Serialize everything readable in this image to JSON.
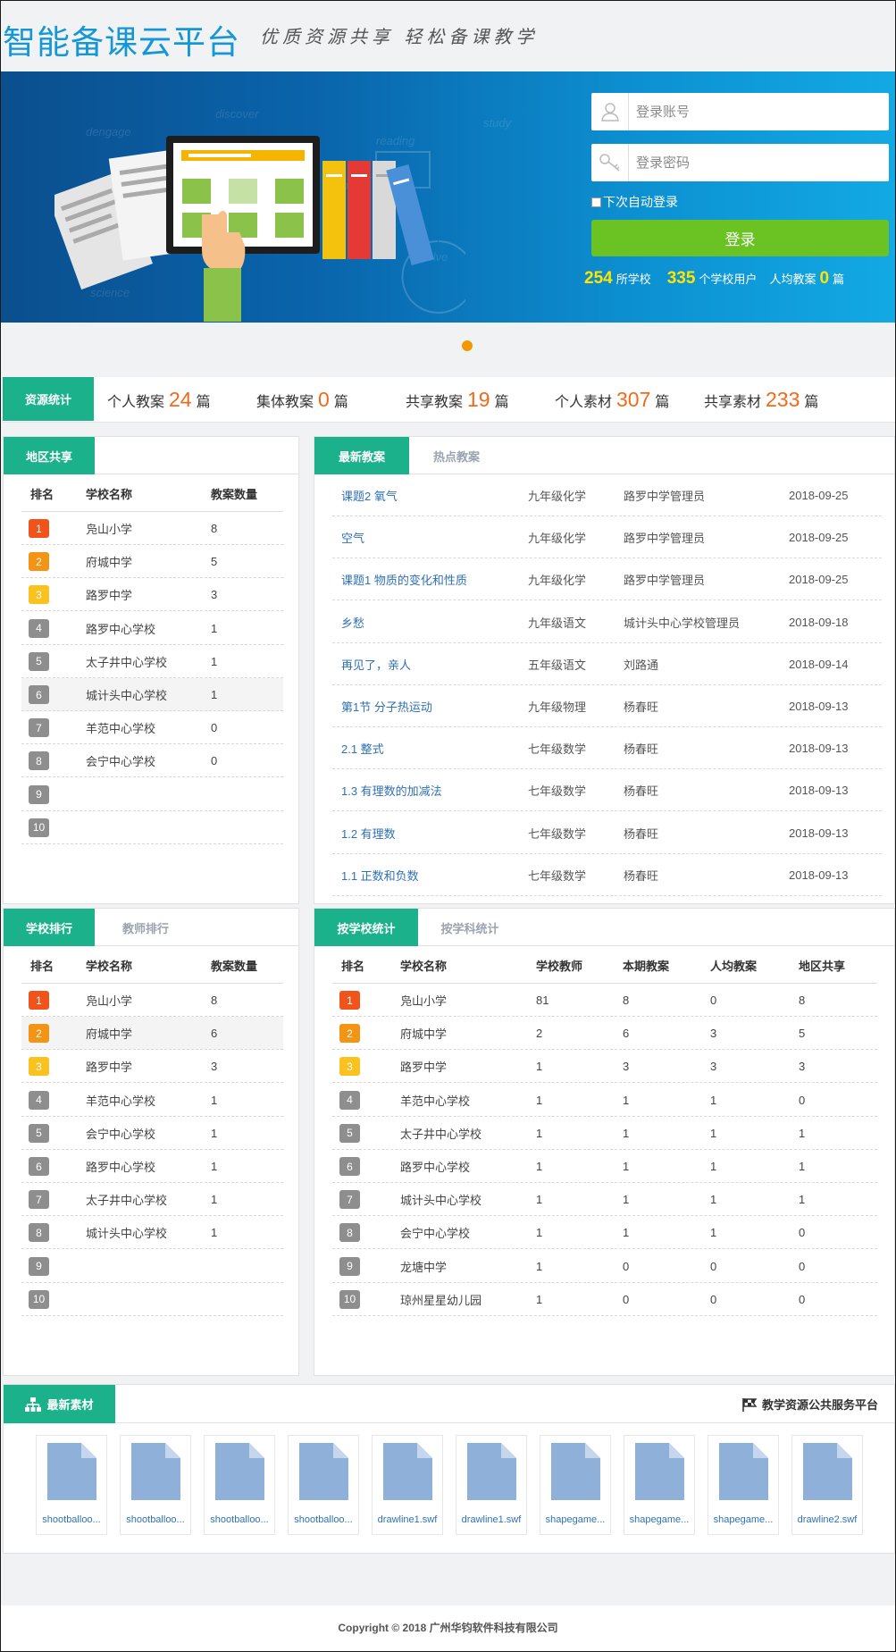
{
  "header": {
    "logo": "智能备课云平台",
    "slogan": "优质资源共享 轻松备课教学"
  },
  "login": {
    "account_placeholder": "登录账号",
    "password_placeholder": "登录密码",
    "remember_label": "下次自动登录",
    "login_button": "登录",
    "stats": {
      "schools_num": "254",
      "schools_unit": "所学校",
      "users_num": "335",
      "users_unit": "个学校用户",
      "avg_label": "人均教案",
      "avg_num": "0",
      "avg_unit": "篇"
    }
  },
  "resource_stats": {
    "tab": "资源统计",
    "items": [
      {
        "label": "个人教案",
        "value": "24",
        "unit": "篇"
      },
      {
        "label": "集体教案",
        "value": "0",
        "unit": "篇"
      },
      {
        "label": "共享教案",
        "value": "19",
        "unit": "篇"
      },
      {
        "label": "个人素材",
        "value": "307",
        "unit": "篇"
      },
      {
        "label": "共享素材",
        "value": "233",
        "unit": "篇"
      }
    ]
  },
  "region_share": {
    "tab": "地区共享",
    "headers": {
      "rank": "排名",
      "school": "学校名称",
      "count": "教案数量"
    },
    "rows": [
      {
        "rank": "1",
        "school": "凫山小学",
        "count": "8"
      },
      {
        "rank": "2",
        "school": "府城中学",
        "count": "5"
      },
      {
        "rank": "3",
        "school": "路罗中学",
        "count": "3"
      },
      {
        "rank": "4",
        "school": "路罗中心学校",
        "count": "1"
      },
      {
        "rank": "5",
        "school": "太子井中心学校",
        "count": "1"
      },
      {
        "rank": "6",
        "school": "城计头中心学校",
        "count": "1"
      },
      {
        "rank": "7",
        "school": "羊范中心学校",
        "count": "0"
      },
      {
        "rank": "8",
        "school": "会宁中心学校",
        "count": "0"
      },
      {
        "rank": "9",
        "school": "",
        "count": ""
      },
      {
        "rank": "10",
        "school": "",
        "count": ""
      }
    ]
  },
  "latest_plans": {
    "tab_active": "最新教案",
    "tab_inactive": "热点教案",
    "rows": [
      {
        "title": "课题2 氧气",
        "grade": "九年级化学",
        "author": "路罗中学管理员",
        "date": "2018-09-25"
      },
      {
        "title": "空气",
        "grade": "九年级化学",
        "author": "路罗中学管理员",
        "date": "2018-09-25"
      },
      {
        "title": "课题1 物质的变化和性质",
        "grade": "九年级化学",
        "author": "路罗中学管理员",
        "date": "2018-09-25"
      },
      {
        "title": "乡愁",
        "grade": "九年级语文",
        "author": "城计头中心学校管理员",
        "date": "2018-09-18"
      },
      {
        "title": "再见了，亲人",
        "grade": "五年级语文",
        "author": "刘路通",
        "date": "2018-09-14"
      },
      {
        "title": "第1节 分子热运动",
        "grade": "九年级物理",
        "author": "杨春旺",
        "date": "2018-09-13"
      },
      {
        "title": "2.1 整式",
        "grade": "七年级数学",
        "author": "杨春旺",
        "date": "2018-09-13"
      },
      {
        "title": "1.3 有理数的加减法",
        "grade": "七年级数学",
        "author": "杨春旺",
        "date": "2018-09-13"
      },
      {
        "title": "1.2 有理数",
        "grade": "七年级数学",
        "author": "杨春旺",
        "date": "2018-09-13"
      },
      {
        "title": "1.1 正数和负数",
        "grade": "七年级数学",
        "author": "杨春旺",
        "date": "2018-09-13"
      }
    ]
  },
  "school_rank": {
    "tab_active": "学校排行",
    "tab_inactive": "教师排行",
    "headers": {
      "rank": "排名",
      "school": "学校名称",
      "count": "教案数量"
    },
    "rows": [
      {
        "rank": "1",
        "school": "凫山小学",
        "count": "8"
      },
      {
        "rank": "2",
        "school": "府城中学",
        "count": "6"
      },
      {
        "rank": "3",
        "school": "路罗中学",
        "count": "3"
      },
      {
        "rank": "4",
        "school": "羊范中心学校",
        "count": "1"
      },
      {
        "rank": "5",
        "school": "会宁中心学校",
        "count": "1"
      },
      {
        "rank": "6",
        "school": "路罗中心学校",
        "count": "1"
      },
      {
        "rank": "7",
        "school": "太子井中心学校",
        "count": "1"
      },
      {
        "rank": "8",
        "school": "城计头中心学校",
        "count": "1"
      },
      {
        "rank": "9",
        "school": "",
        "count": ""
      },
      {
        "rank": "10",
        "school": "",
        "count": ""
      }
    ]
  },
  "school_stats": {
    "tab_active": "按学校统计",
    "tab_inactive": "按学科统计",
    "headers": {
      "rank": "排名",
      "school": "学校名称",
      "teachers": "学校教师",
      "period": "本期教案",
      "avg": "人均教案",
      "share": "地区共享"
    },
    "rows": [
      {
        "rank": "1",
        "school": "凫山小学",
        "teachers": "81",
        "period": "8",
        "avg": "0",
        "share": "8"
      },
      {
        "rank": "2",
        "school": "府城中学",
        "teachers": "2",
        "period": "6",
        "avg": "3",
        "share": "5"
      },
      {
        "rank": "3",
        "school": "路罗中学",
        "teachers": "1",
        "period": "3",
        "avg": "3",
        "share": "3"
      },
      {
        "rank": "4",
        "school": "羊范中心学校",
        "teachers": "1",
        "period": "1",
        "avg": "1",
        "share": "0"
      },
      {
        "rank": "5",
        "school": "太子井中心学校",
        "teachers": "1",
        "period": "1",
        "avg": "1",
        "share": "1"
      },
      {
        "rank": "6",
        "school": "路罗中心学校",
        "teachers": "1",
        "period": "1",
        "avg": "1",
        "share": "1"
      },
      {
        "rank": "7",
        "school": "城计头中心学校",
        "teachers": "1",
        "period": "1",
        "avg": "1",
        "share": "1"
      },
      {
        "rank": "8",
        "school": "会宁中心学校",
        "teachers": "1",
        "period": "1",
        "avg": "1",
        "share": "0"
      },
      {
        "rank": "9",
        "school": "龙塘中学",
        "teachers": "1",
        "period": "0",
        "avg": "0",
        "share": "0"
      },
      {
        "rank": "10",
        "school": "琼州星星幼儿园",
        "teachers": "1",
        "period": "0",
        "avg": "0",
        "share": "0"
      }
    ]
  },
  "materials": {
    "tab": "最新素材",
    "right_title": "教学资源公共服务平台",
    "items": [
      "shootballoo...",
      "shootballoo...",
      "shootballoo...",
      "shootballoo...",
      "drawline1.swf",
      "drawline1.swf",
      "shapegame...",
      "shapegame...",
      "shapegame...",
      "drawline2.swf"
    ]
  },
  "footer": {
    "copyright": "Copyright © 2018 广州华钧软件科技有限公司"
  },
  "colors": {
    "brand_blue": "#1597d6",
    "tab_green": "#1bb18a",
    "login_green": "#6ac322",
    "stat_orange": "#f26a19",
    "stat_yellow": "#ffe400",
    "rank1": "#f0541b",
    "rank2": "#f39415",
    "rank3": "#f9c21e",
    "rank_other": "#8e8e8e"
  }
}
